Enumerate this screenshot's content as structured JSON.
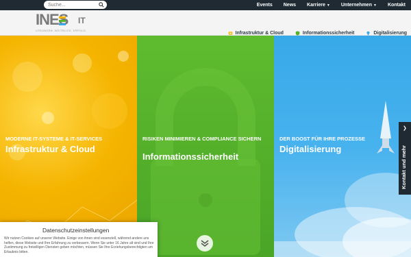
{
  "search": {
    "placeholder": "Suche..."
  },
  "topnav": {
    "events": "Events",
    "news": "News",
    "karriere": "Karriere",
    "unternehmen": "Unternehmen",
    "kontakt": "Kontakt"
  },
  "logo": {
    "text": "INES",
    "suffix": "IT",
    "tagline": "LÖSUNGEN. WEITBLICK. ERFOLG."
  },
  "mainnav": {
    "infra": "Infrastruktur & Cloud",
    "security": "Informationssicherheit",
    "digital": "Digitalisierung"
  },
  "panels": [
    {
      "kicker": "Moderne IT-Systeme & IT-Services",
      "title": "Infrastruktur & Cloud"
    },
    {
      "kicker": "Risiken minimieren & Compliance sichern",
      "title": "Informationssicherheit"
    },
    {
      "kicker": "Der Boost für Ihre Prozesse",
      "title": "Digitalisierung"
    }
  ],
  "side_tab": {
    "label": "Kontakt und mehr"
  },
  "cookie": {
    "title": "Datenschutzeinstellungen",
    "text": "Wir nutzen Cookies auf unserer Website. Einige von ihnen sind essenziell, während andere uns helfen, diese Website und Ihre Erfahrung zu verbessern. Wenn Sie unter 16 Jahre alt sind und Ihre Zustimmung zu freiwilligen Diensten geben möchten, müssen Sie Ihre Erziehungsberechtigten um Erlaubnis bitten."
  },
  "colors": {
    "topbar": "#1f2a33",
    "yellow": "#f5b400",
    "green": "#56b22a",
    "blue": "#3aa9e8"
  }
}
